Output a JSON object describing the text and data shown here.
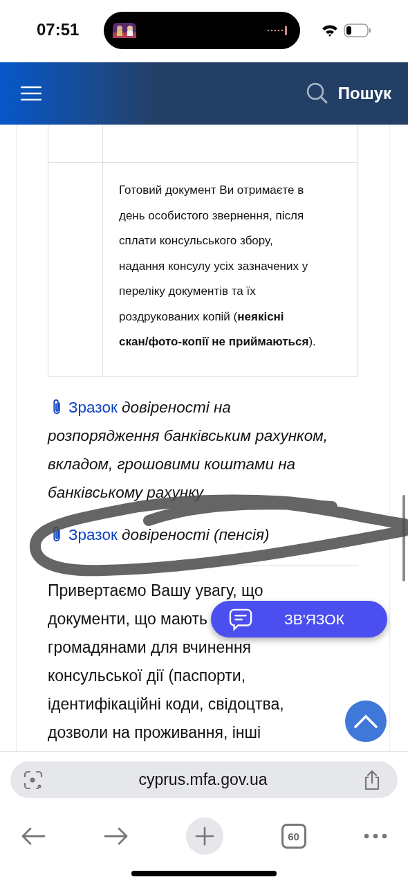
{
  "status_bar": {
    "time": "07:51"
  },
  "header": {
    "search_label": "Пошук"
  },
  "table": {
    "detail_cell": {
      "lines": [
        "Готовий документ Ви отримаєте в",
        "день особистого звернення, після",
        "сплати консульського збору,",
        "надання консулу усіх зазначених у",
        "переліку документів та їх",
        "роздрукованих копій (**неякісні**",
        "**скан/фото-копії не приймаються**)."
      ]
    }
  },
  "attachments": [
    {
      "link": "Зразок",
      "lines": [
        "довіреності на",
        "розпорядження банківським рахунком,",
        "вкладом, грошовими коштами на",
        "банківському рахунку"
      ]
    },
    {
      "link": "Зразок",
      "lines": [
        "довіреності (пенсія)"
      ]
    }
  ],
  "notice": {
    "lines": [
      "Привертаємо Вашу увагу, що",
      "документи, що мають",
      "громадянами для вчинення",
      "консульської дії (паспорти,",
      "ідентифікаційні коди, свідоцтва,",
      "дозволи на проживання, інші"
    ]
  },
  "contact_button": {
    "label": "ЗВ'ЯЗОК"
  },
  "browser": {
    "url": "cyprus.mfa.gov.ua",
    "tab_count": "60"
  }
}
